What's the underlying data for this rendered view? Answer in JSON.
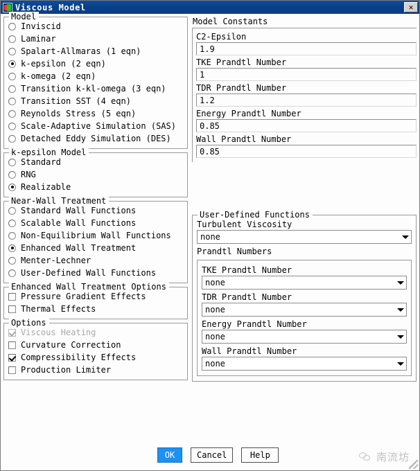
{
  "window": {
    "title": "Viscous Model",
    "close_label": "✕",
    "app_icon": "fluent-app-icon"
  },
  "model_group": {
    "title": "Model",
    "selected": "k-epsilon (2 eqn)",
    "options": [
      "Inviscid",
      "Laminar",
      "Spalart-Allmaras (1 eqn)",
      "k-epsilon (2 eqn)",
      "k-omega (2 eqn)",
      "Transition k-kl-omega (3 eqn)",
      "Transition SST (4 eqn)",
      "Reynolds Stress (5 eqn)",
      "Scale-Adaptive Simulation (SAS)",
      "Detached Eddy Simulation (DES)"
    ]
  },
  "kepsilon_group": {
    "title": "k-epsilon Model",
    "selected": "Realizable",
    "options": [
      "Standard",
      "RNG",
      "Realizable"
    ]
  },
  "near_wall_group": {
    "title": "Near-Wall Treatment",
    "selected": "Enhanced Wall Treatment",
    "options": [
      "Standard Wall Functions",
      "Scalable Wall Functions",
      "Non-Equilibrium Wall Functions",
      "Enhanced Wall Treatment",
      "Menter-Lechner",
      "User-Defined Wall Functions"
    ]
  },
  "ewt_options_group": {
    "title": "Enhanced Wall Treatment Options",
    "options": [
      {
        "label": "Pressure Gradient Effects",
        "checked": false,
        "disabled": false
      },
      {
        "label": "Thermal Effects",
        "checked": false,
        "disabled": false
      }
    ]
  },
  "options_group": {
    "title": "Options",
    "options": [
      {
        "label": "Viscous Heating",
        "checked": true,
        "disabled": true
      },
      {
        "label": "Curvature Correction",
        "checked": false,
        "disabled": false
      },
      {
        "label": "Compressibility Effects",
        "checked": true,
        "disabled": false
      },
      {
        "label": "Production Limiter",
        "checked": false,
        "disabled": false
      }
    ]
  },
  "model_constants": {
    "title": "Model Constants",
    "fields": [
      {
        "label": "C2-Epsilon",
        "value": "1.9"
      },
      {
        "label": "TKE Prandtl Number",
        "value": "1"
      },
      {
        "label": "TDR Prandtl Number",
        "value": "1.2"
      },
      {
        "label": "Energy Prandtl Number",
        "value": "0.85"
      },
      {
        "label": "Wall Prandtl Number",
        "value": "0.85"
      }
    ]
  },
  "udf_group": {
    "title": "User-Defined Functions",
    "turbulent_viscosity": {
      "label": "Turbulent Viscosity",
      "value": "none"
    },
    "prandtl_numbers": {
      "title": "Prandtl Numbers",
      "fields": [
        {
          "label": "TKE Prandtl Number",
          "value": "none"
        },
        {
          "label": "TDR Prandtl Number",
          "value": "none"
        },
        {
          "label": "Energy Prandtl Number",
          "value": "none"
        },
        {
          "label": "Wall Prandtl Number",
          "value": "none"
        }
      ]
    }
  },
  "footer": {
    "ok": "OK",
    "cancel": "Cancel",
    "help": "Help",
    "watermark": "南流坊"
  },
  "colors": {
    "titlebar": "#0a3f86",
    "primary_button": "#1e90f0",
    "dialog_bg": "#fdfdfd",
    "border": "#9a9a9a"
  }
}
